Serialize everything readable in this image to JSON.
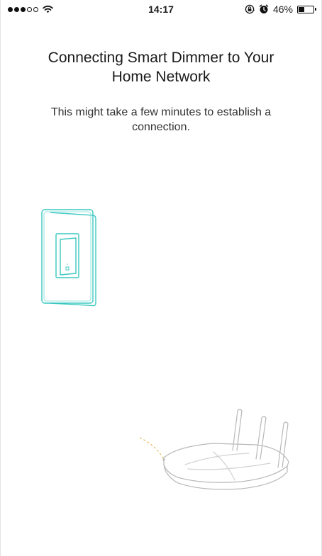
{
  "status_bar": {
    "time": "14:17",
    "battery_percent": "46%",
    "battery_level": 0.46,
    "signal_bars_filled": 3,
    "signal_bars_total": 5,
    "icons": [
      "signal-dots-icon",
      "wifi-icon",
      "rotation-lock-icon",
      "alarm-icon",
      "battery-icon"
    ]
  },
  "screen": {
    "title": "Connecting Smart Dimmer to Your Home Network",
    "subtitle": "This might take a few minutes to establish a connection."
  },
  "illustrations": {
    "switch": "dimmer-switch-illustration",
    "router": "wifi-router-illustration",
    "accent_color": "#3cc8c0",
    "signal_color": "#e6c46a"
  }
}
